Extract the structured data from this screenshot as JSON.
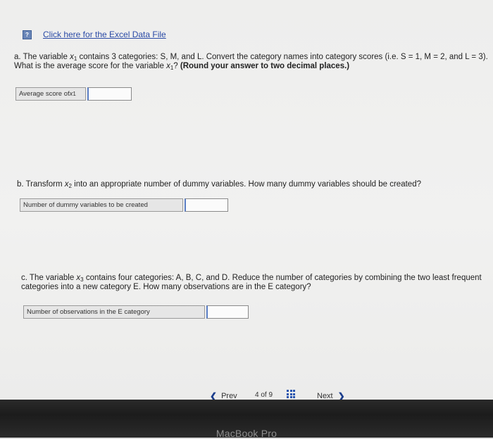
{
  "excel_link": {
    "icon": "file-icon",
    "label": "Click here for the Excel Data File"
  },
  "part_a": {
    "line1_prefix": "a. The variable ",
    "var_base": "x",
    "var_sub": "1",
    "line1_suffix": " contains 3 categories: S, M, and L. Convert the category names into category scores (i.e. S = 1, M = 2, and L = 3).",
    "line2_prefix": "What is the average score for the variable ",
    "line2_mid": "? ",
    "line2_bold": "(Round your answer to two decimal places.)",
    "answer_label_prefix": "Average score of ",
    "answer_value": ""
  },
  "part_b": {
    "prefix": "b. Transform ",
    "var_base": "x",
    "var_sub": "2",
    "suffix": " into an appropriate number of dummy variables. How many dummy variables should be created?",
    "answer_label": "Number of dummy variables to be created",
    "answer_value": ""
  },
  "part_c": {
    "line1_prefix": "c. The variable ",
    "var_base": "x",
    "var_sub": "3",
    "line1_suffix": " contains four categories: A, B, C, and D. Reduce the number of categories by combining the two least frequent",
    "line2": "categories into a new category E. How many observations are in the E category?",
    "answer_label": "Number of observations in the E category",
    "answer_value": ""
  },
  "navigation": {
    "prev_label": "Prev",
    "page_current": "4",
    "page_sep": "of",
    "page_total": "9",
    "next_label": "Next",
    "grid_icon": "grid-icon"
  },
  "bezel": {
    "brand": "MacBook Pro"
  }
}
